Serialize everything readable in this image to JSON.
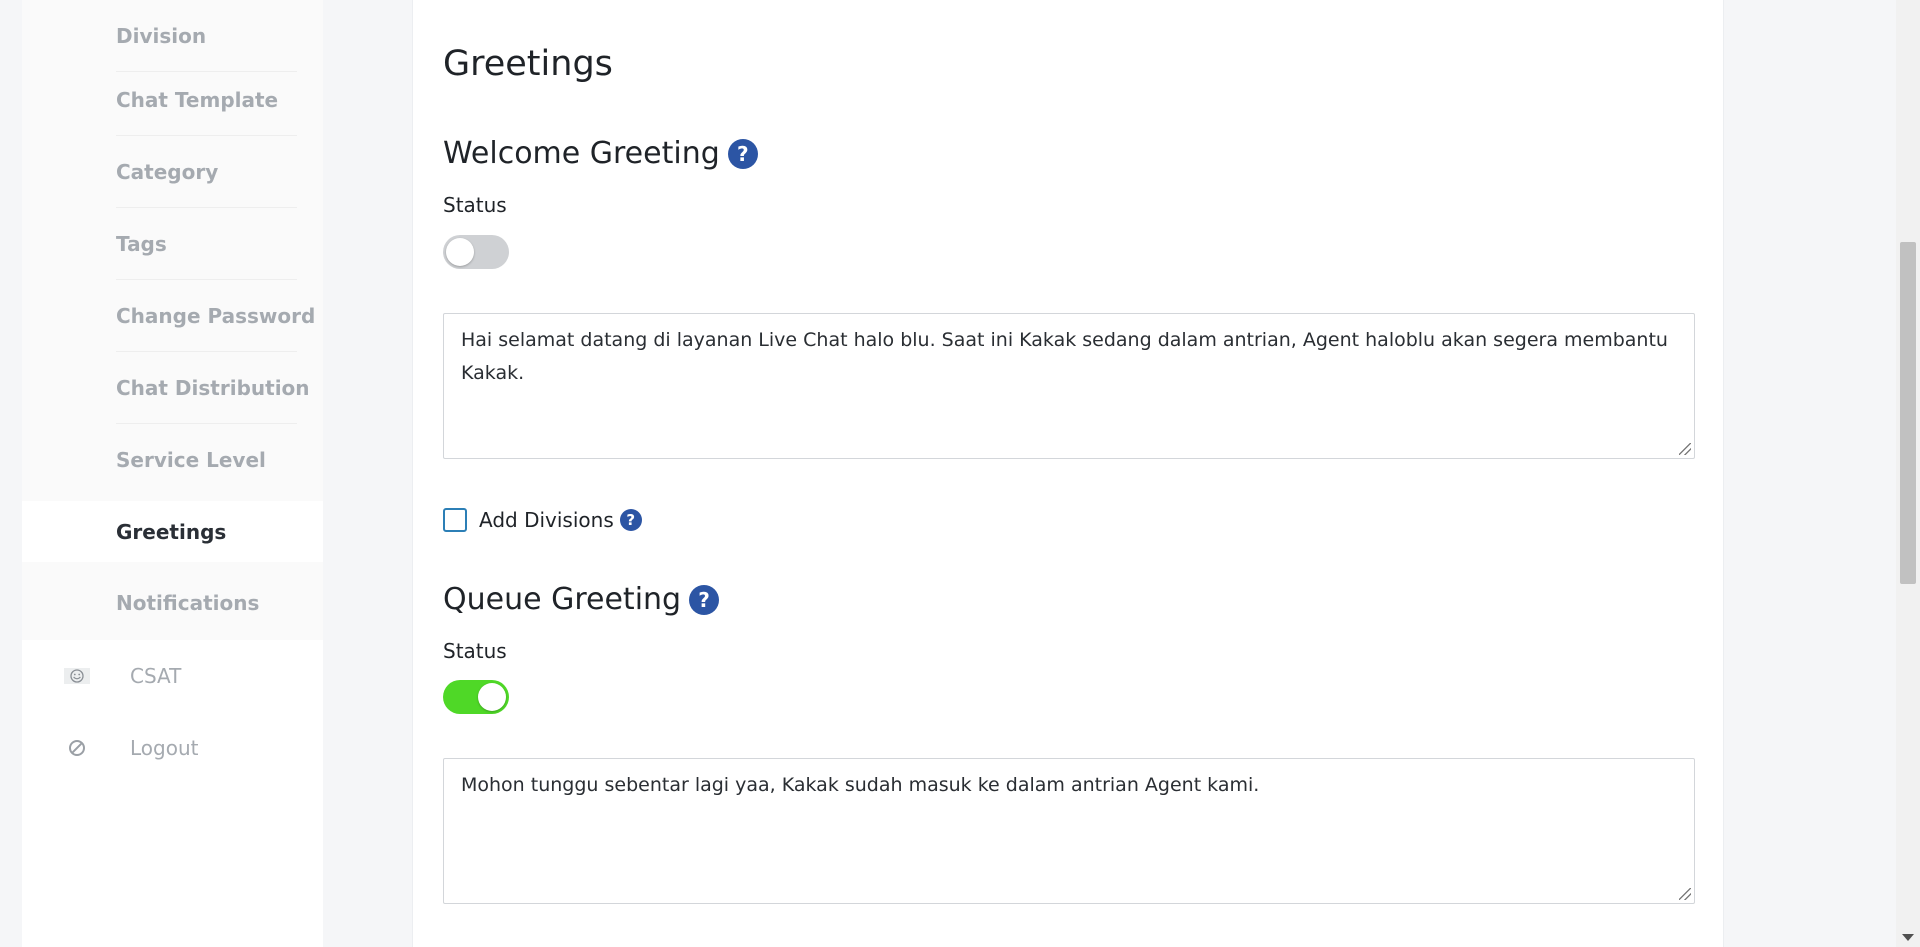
{
  "sidebar": {
    "submenu": [
      {
        "label": "Division",
        "active": false
      },
      {
        "label": "Chat Template",
        "active": false
      },
      {
        "label": "Category",
        "active": false
      },
      {
        "label": "Tags",
        "active": false
      },
      {
        "label": "Change Password",
        "active": false
      },
      {
        "label": "Chat Distribution",
        "active": false
      },
      {
        "label": "Service Level",
        "active": false
      },
      {
        "label": "Greetings",
        "active": true
      },
      {
        "label": "Notifications",
        "active": false
      }
    ],
    "menu": [
      {
        "label": "CSAT",
        "icon": "smile-icon"
      },
      {
        "label": "Logout",
        "icon": "logout-icon"
      }
    ]
  },
  "main": {
    "title": "Greetings",
    "welcome": {
      "title": "Welcome Greeting",
      "help": "?",
      "status_label": "Status",
      "status_on": false,
      "message": "Hai selamat datang di layanan Live Chat halo blu. Saat ini Kakak sedang dalam antrian, Agent haloblu akan segera membantu Kakak."
    },
    "add_divisions": {
      "label": "Add Divisions",
      "checked": false,
      "help": "?"
    },
    "queue": {
      "title": "Queue Greeting",
      "help": "?",
      "status_label": "Status",
      "status_on": true,
      "message": "Mohon tunggu sebentar lagi yaa, Kakak sudah masuk ke dalam antrian Agent kami."
    }
  },
  "colors": {
    "accent": "#2c55a4",
    "toggle_on": "#4fd827",
    "toggle_off": "#cfd1d4"
  }
}
